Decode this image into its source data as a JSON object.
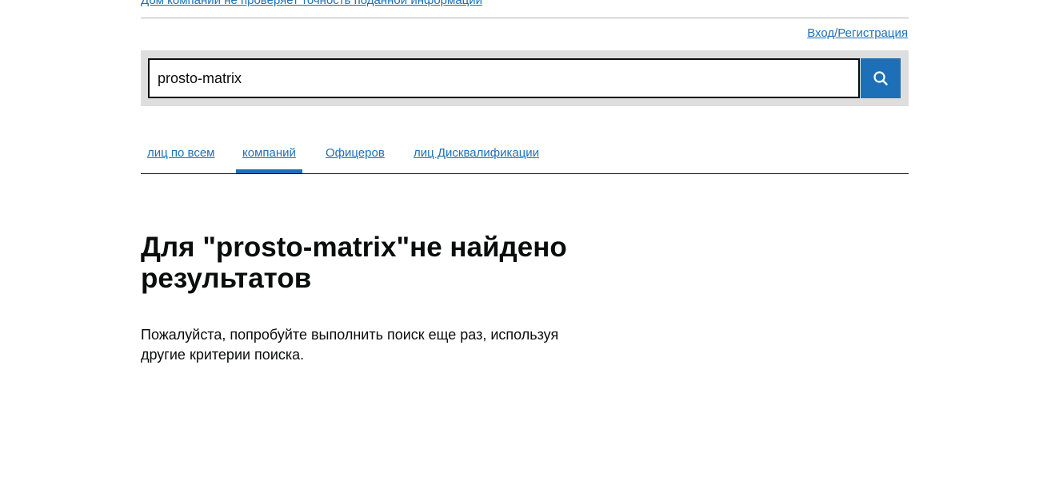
{
  "header": {
    "disclaimer_link": "Дом компании не проверяет точность поданной информации",
    "login_link": "Вход/Регистрация"
  },
  "search": {
    "value": "prosto-matrix",
    "button_icon": "search-icon"
  },
  "tabs": [
    {
      "label": "лиц по всем",
      "active": false
    },
    {
      "label": "компаний",
      "active": true
    },
    {
      "label": "Офицеров",
      "active": false
    },
    {
      "label": "лиц Дисквалификации",
      "active": false
    }
  ],
  "results": {
    "heading": "Для \"prosto-matrix\"не найдено результатов",
    "message": "Пожалуйста, попробуйте выполнить поиск еще раз, используя другие критерии поиска."
  },
  "colors": {
    "link": "#1d70b8",
    "search_bar_bg": "#dedede",
    "text": "#0b0c0c"
  }
}
